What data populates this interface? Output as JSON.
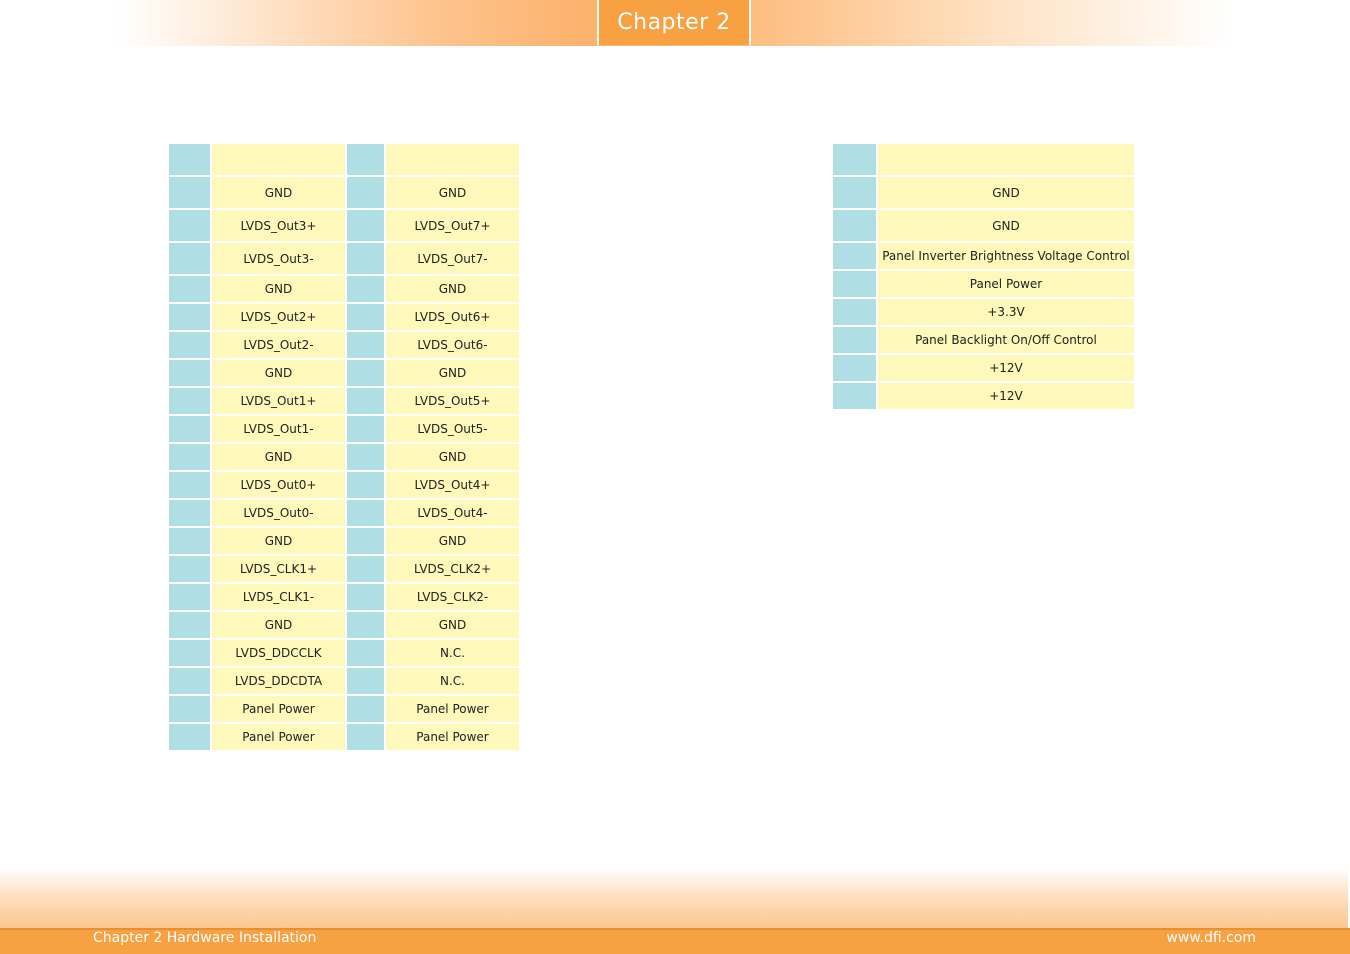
{
  "header": {
    "chapter_label": "Chapter 2"
  },
  "table_left": {
    "rows": [
      [
        "GND",
        "GND"
      ],
      [
        "LVDS_Out3+",
        "LVDS_Out7+"
      ],
      [
        "LVDS_Out3-",
        "LVDS_Out7-"
      ],
      [
        "GND",
        "GND"
      ],
      [
        "LVDS_Out2+",
        "LVDS_Out6+"
      ],
      [
        "LVDS_Out2-",
        "LVDS_Out6-"
      ],
      [
        "GND",
        "GND"
      ],
      [
        "LVDS_Out1+",
        "LVDS_Out5+"
      ],
      [
        "LVDS_Out1-",
        "LVDS_Out5-"
      ],
      [
        "GND",
        "GND"
      ],
      [
        "LVDS_Out0+",
        "LVDS_Out4+"
      ],
      [
        "LVDS_Out0-",
        "LVDS_Out4-"
      ],
      [
        "GND",
        "GND"
      ],
      [
        "LVDS_CLK1+",
        "LVDS_CLK2+"
      ],
      [
        "LVDS_CLK1-",
        "LVDS_CLK2-"
      ],
      [
        "GND",
        "GND"
      ],
      [
        "LVDS_DDCCLK",
        "N.C."
      ],
      [
        "LVDS_DDCDTA",
        "N.C."
      ],
      [
        "Panel Power",
        "Panel Power"
      ],
      [
        "Panel Power",
        "Panel Power"
      ]
    ]
  },
  "table_right": {
    "rows": [
      "GND",
      "GND",
      "Panel Inverter Brightness Voltage Control",
      "Panel Power",
      "+3.3V",
      "Panel Backlight On/Off Control",
      "+12V",
      "+12V"
    ]
  },
  "footer": {
    "left_text": "Chapter 2 Hardware Installation",
    "right_text": "www.dfi.com"
  },
  "colors": {
    "accent_orange": "#f7a142",
    "pin_cell": "#afdfe4",
    "signal_cell": "#fef8bb"
  }
}
